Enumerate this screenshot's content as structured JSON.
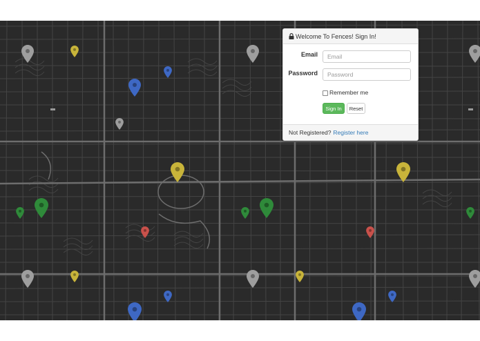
{
  "login": {
    "title": "Welcome To Fences! Sign In!",
    "email_label": "Email",
    "email_placeholder": "Email",
    "password_label": "Password",
    "password_placeholder": "Password",
    "remember_label": "Remember me",
    "signin_label": "Sign In",
    "reset_label": "Reset",
    "not_registered_text": "Not Registered?",
    "register_link": "Register here"
  },
  "map": {
    "background_color": "#2a2a2a",
    "pins": [
      {
        "color": "#9e9e9e",
        "size": "md"
      },
      {
        "color": "#c8b43a",
        "size": "sm"
      },
      {
        "color": "#3e68c4",
        "size": "sm"
      },
      {
        "color": "#3e68c4",
        "size": "md"
      },
      {
        "color": "#9e9e9e",
        "size": "md"
      },
      {
        "color": "#9e9e9e",
        "size": "sm"
      },
      {
        "color": "#c8b43a",
        "size": "lg"
      },
      {
        "color": "#c8b43a",
        "size": "lg"
      },
      {
        "color": "#2f8a3a",
        "size": "sm"
      },
      {
        "color": "#2f8a3a",
        "size": "lg"
      },
      {
        "color": "#2f8a3a",
        "size": "sm"
      },
      {
        "color": "#2f8a3a",
        "size": "lg"
      },
      {
        "color": "#2f8a3a",
        "size": "sm"
      },
      {
        "color": "#c9514b",
        "size": "sm"
      },
      {
        "color": "#c9514b",
        "size": "sm"
      },
      {
        "color": "#9e9e9e",
        "size": "md"
      },
      {
        "color": "#c8b43a",
        "size": "sm"
      },
      {
        "color": "#9e9e9e",
        "size": "md"
      },
      {
        "color": "#c8b43a",
        "size": "sm"
      },
      {
        "color": "#3e68c4",
        "size": "sm"
      },
      {
        "color": "#3e68c4",
        "size": "sm"
      },
      {
        "color": "#3e68c4",
        "size": "lg"
      },
      {
        "color": "#3e68c4",
        "size": "lg"
      },
      {
        "color": "#9e9e9e",
        "size": "md"
      },
      {
        "color": "#9e9e9e",
        "size": "md"
      }
    ]
  }
}
